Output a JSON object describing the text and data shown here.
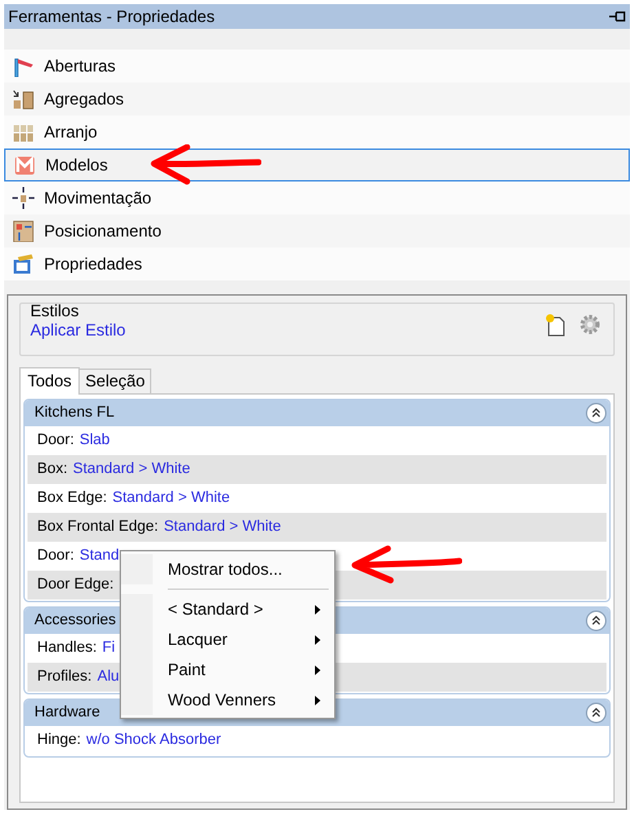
{
  "window": {
    "title": "Ferramentas - Propriedades"
  },
  "tools": [
    {
      "label": "Aberturas",
      "selected": false
    },
    {
      "label": "Agregados",
      "selected": false
    },
    {
      "label": "Arranjo",
      "selected": false
    },
    {
      "label": "Modelos",
      "selected": true
    },
    {
      "label": "Movimentação",
      "selected": false
    },
    {
      "label": "Posicionamento",
      "selected": false
    },
    {
      "label": "Propriedades",
      "selected": false
    }
  ],
  "styles": {
    "legend": "Estilos",
    "link": "Aplicar Estilo"
  },
  "tabs": [
    {
      "label": "Todos",
      "selected": true
    },
    {
      "label": "Seleção",
      "selected": false
    }
  ],
  "groups": [
    {
      "title": "Kitchens FL",
      "expanded": true,
      "rows": [
        {
          "label": "Door:",
          "value": "Slab"
        },
        {
          "label": "Box:",
          "value": "Standard > White"
        },
        {
          "label": "Box Edge:",
          "value": "Standard > White"
        },
        {
          "label": "Box Frontal Edge:",
          "value": "Standard > White"
        },
        {
          "label": "Door:",
          "value": "Stand"
        },
        {
          "label": "Door Edge:"
        }
      ]
    },
    {
      "title": "Accessories",
      "expanded": true,
      "rows": [
        {
          "label": "Handles:",
          "value": "Fi"
        },
        {
          "label": "Profiles:",
          "value": "Alu"
        }
      ]
    },
    {
      "title": "Hardware",
      "expanded": true,
      "rows": [
        {
          "label": "Hinge:",
          "value": "w/o Shock Absorber"
        }
      ]
    }
  ],
  "context_menu": {
    "items": [
      {
        "label": "Mostrar todos...",
        "kind": "command"
      },
      {
        "kind": "separator"
      },
      {
        "label": "< Standard >",
        "kind": "submenu"
      },
      {
        "label": "Lacquer",
        "kind": "submenu"
      },
      {
        "label": "Paint",
        "kind": "submenu"
      },
      {
        "label": "Wood Venners",
        "kind": "submenu"
      }
    ]
  }
}
